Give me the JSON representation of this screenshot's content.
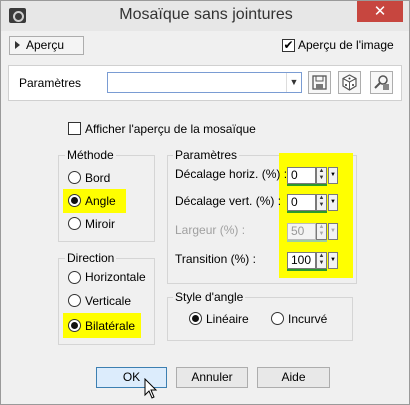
{
  "window": {
    "title": "Mosaïque sans jointures",
    "close_glyph": "✕"
  },
  "preview": {
    "toggle_label": "Aperçu",
    "checkbox_label": "Aperçu de l'image",
    "checkbox_checked": true
  },
  "parameters_bar": {
    "label": "Paramètres",
    "preset_value": "",
    "tools": [
      "save-preset-icon",
      "random-dice-icon",
      "reset-defaults-icon"
    ]
  },
  "options": {
    "show_tile_preview_label": "Afficher l'aperçu de la mosaïque",
    "show_tile_preview_checked": false
  },
  "methode": {
    "title": "Méthode",
    "items": [
      {
        "label": "Bord",
        "selected": false
      },
      {
        "label": "Angle",
        "selected": true
      },
      {
        "label": "Miroir",
        "selected": false
      }
    ]
  },
  "direction": {
    "title": "Direction",
    "items": [
      {
        "label": "Horizontale",
        "selected": false
      },
      {
        "label": "Verticale",
        "selected": false
      },
      {
        "label": "Bilatérale",
        "selected": true
      }
    ]
  },
  "parametres": {
    "title": "Paramètres",
    "fields": [
      {
        "label": "Décalage horiz. (%) :",
        "value": "0",
        "enabled": true,
        "fill": 0
      },
      {
        "label": "Décalage vert. (%) :",
        "value": "0",
        "enabled": true,
        "fill": 0
      },
      {
        "label": "Largeur (%) :",
        "value": "50",
        "enabled": false,
        "fill": 50
      },
      {
        "label": "Transition (%) :",
        "value": "100",
        "enabled": true,
        "fill": 100
      }
    ]
  },
  "style_angle": {
    "title": "Style d'angle",
    "items": [
      {
        "label": "Linéaire",
        "selected": true
      },
      {
        "label": "Incurvé",
        "selected": false
      }
    ]
  },
  "buttons": {
    "ok": "OK",
    "cancel": "Annuler",
    "help": "Aide"
  },
  "colors": {
    "highlight": "#ffff00",
    "spin_bar": "#2c9a2c",
    "close": "#c7463f"
  }
}
